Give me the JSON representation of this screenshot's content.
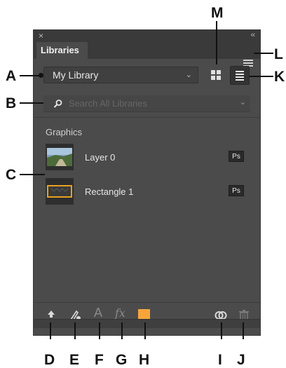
{
  "panel": {
    "close_glyph": "×",
    "collapse_glyph": "‹‹",
    "tab_label": "Libraries",
    "library_select": {
      "selected": "My Library",
      "chevron": "⌄"
    },
    "search": {
      "placeholder": "Search All Libraries",
      "chevron": "⌄"
    },
    "group_label": "Graphics",
    "items": [
      {
        "name": "Layer 0",
        "badge": "Ps"
      },
      {
        "name": "Rectangle 1",
        "badge": "Ps"
      }
    ],
    "footer": {
      "text_style_glyph": "A",
      "effects_glyph": "fx",
      "swatch_color": "#f6a53c"
    }
  },
  "callouts": {
    "A": "A",
    "B": "B",
    "C": "C",
    "D": "D",
    "E": "E",
    "F": "F",
    "G": "G",
    "H": "H",
    "I": "I",
    "J": "J",
    "K": "K",
    "L": "L",
    "M": "M"
  },
  "icons": [
    "flyout-menu-icon",
    "grid-view-icon",
    "list-view-icon",
    "search-icon",
    "upload-icon",
    "add-graphic-icon",
    "text-style-icon",
    "layer-style-icon",
    "color-swatch",
    "creative-cloud-sync-icon",
    "trash-icon"
  ]
}
